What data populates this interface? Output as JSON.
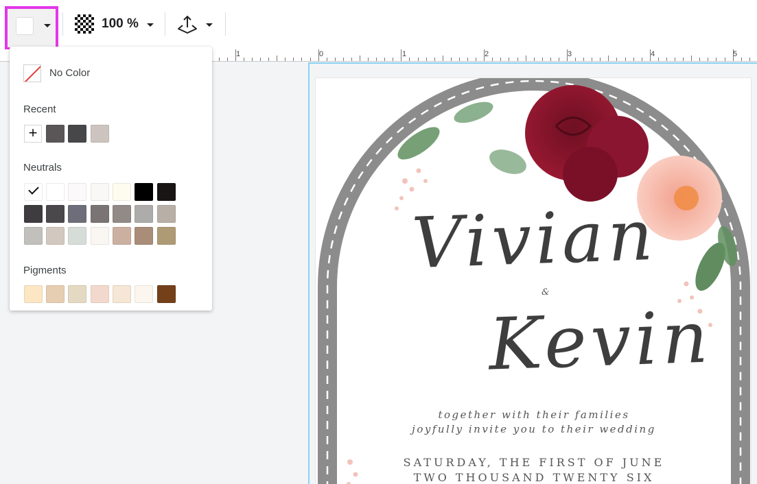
{
  "toolbar": {
    "fill_color": "#ffffff",
    "opacity_label": "100 %"
  },
  "ruler": {
    "labels": [
      "1",
      "0",
      "1",
      "2",
      "3",
      "4",
      "5"
    ]
  },
  "color_panel": {
    "no_color_label": "No Color",
    "recent_title": "Recent",
    "recent": [
      "#5a5657",
      "#47474a",
      "#cdc4c0"
    ],
    "neutrals_title": "Neutrals",
    "neutrals": [
      [
        "#ffffff",
        "#ffffff",
        "#fbf9fa",
        "#faf8f6",
        "#fdfcef",
        "#000000",
        "#1a1515"
      ],
      [
        "#3e3c3f",
        "#4a484b",
        "#6e6e7b",
        "#7a7475",
        "#928a86",
        "#adacaa",
        "#b8b0a6"
      ],
      [
        "#c2c0bd",
        "#d2c8c0",
        "#d6ddd8",
        "#faf7f2",
        "#cbb0a1",
        "#a98d79",
        "#ae9b76"
      ]
    ],
    "neutrals_selected": "#ffffff",
    "pigments_title": "Pigments",
    "pigments": [
      "#fce6c4",
      "#e6ceb2",
      "#e4d9c2",
      "#f3d9cd",
      "#f5e6d5",
      "#fbf7ee",
      "#73401a"
    ]
  },
  "card": {
    "name_1": "Vivian",
    "ampersand": "&",
    "name_2": "Kevin",
    "line_1": "together with their families",
    "line_2": "joyfully invite you to their wedding",
    "line_3": "SATURDAY, THE FIRST OF JUNE",
    "line_4": "TWO THOUSAND TWENTY SIX"
  }
}
